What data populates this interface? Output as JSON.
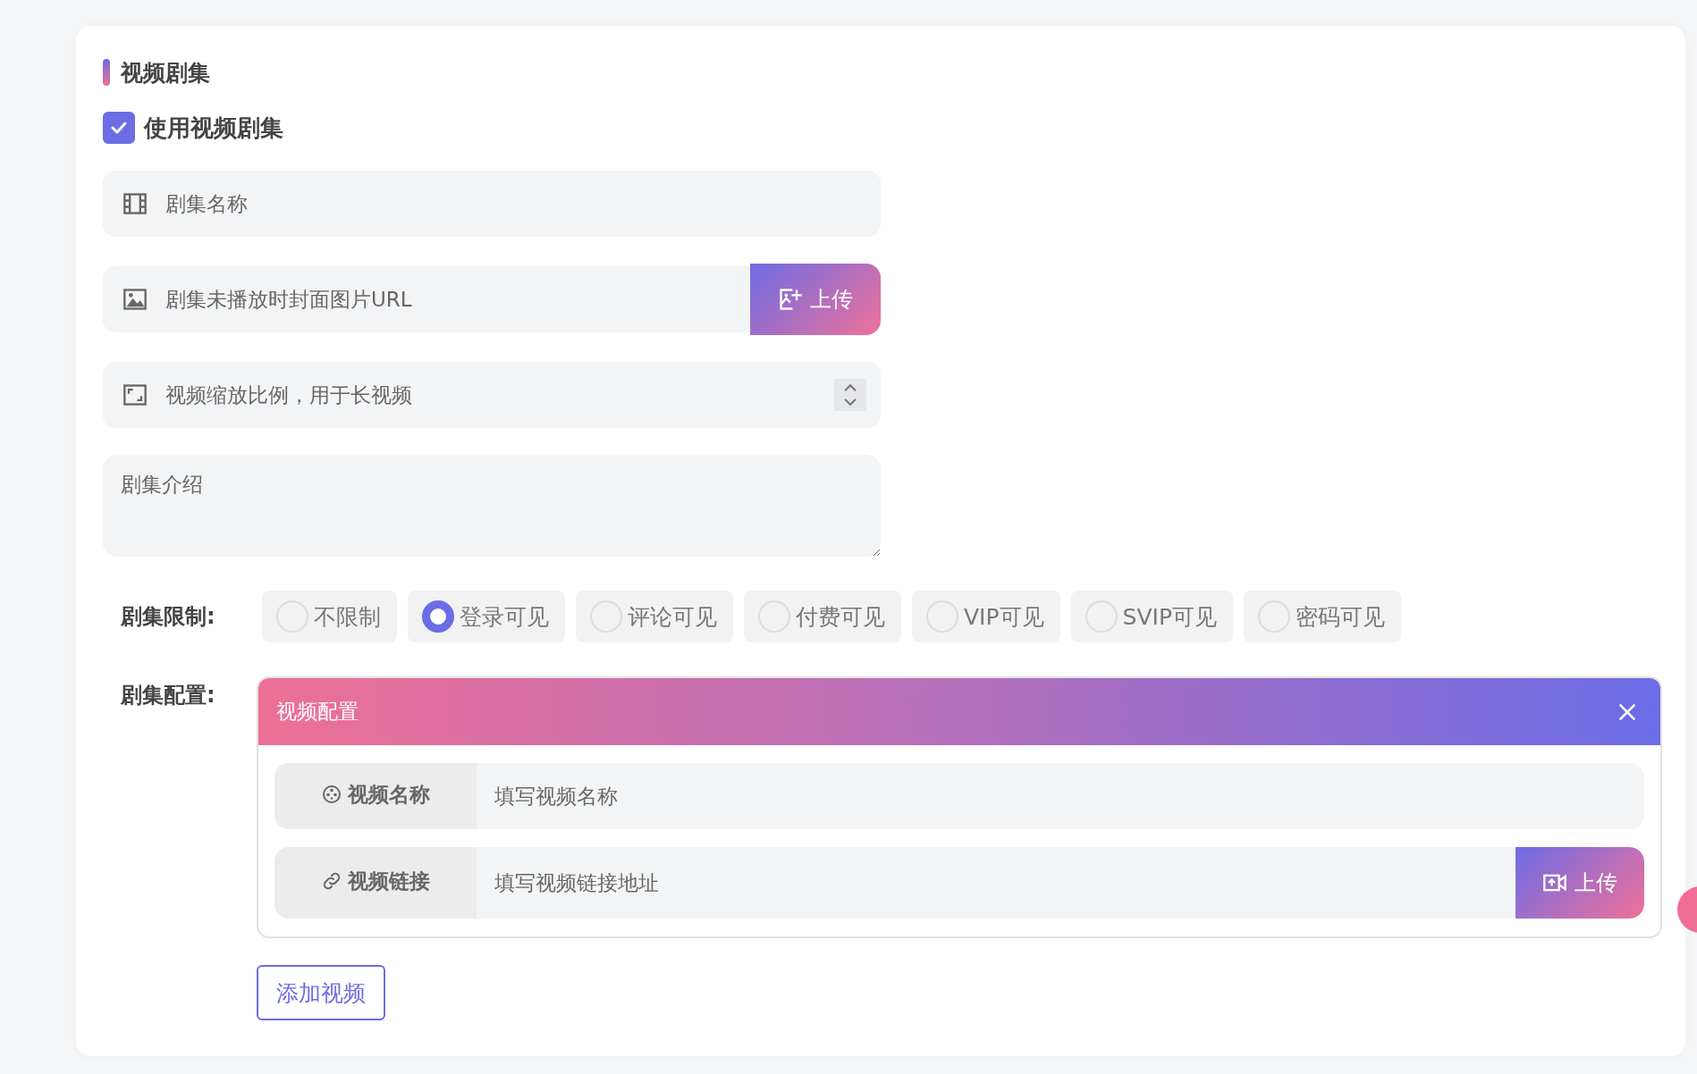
{
  "section": {
    "title": "视频剧集"
  },
  "use_series": {
    "label": "使用视频剧集",
    "checked": true
  },
  "fields": [
    {
      "kind": "text",
      "placeholder": "剧集名称"
    },
    {
      "kind": "upload",
      "placeholder": "剧集未播放时封面图片URL",
      "button": "上传"
    },
    {
      "kind": "select",
      "placeholder": "视频缩放比例，用于长视频"
    },
    {
      "kind": "textarea",
      "placeholder": "剧集介绍"
    }
  ],
  "restriction": {
    "label": "剧集限制:",
    "options": [
      {
        "label": "不限制",
        "selected": false
      },
      {
        "label": "登录可见",
        "selected": true
      },
      {
        "label": "评论可见",
        "selected": false
      },
      {
        "label": "付费可见",
        "selected": false
      },
      {
        "label": "VIP可见",
        "selected": false
      },
      {
        "label": "SVIP可见",
        "selected": false
      },
      {
        "label": "密码可见",
        "selected": false
      }
    ]
  },
  "config": {
    "label": "剧集配置:",
    "panels": [
      {
        "title": "视频配置",
        "rows": [
          {
            "kind": "text",
            "label": "视频名称",
            "placeholder": "填写视频名称"
          },
          {
            "kind": "upload",
            "label": "视频链接",
            "placeholder": "填写视频链接地址",
            "button": "上传"
          }
        ]
      }
    ],
    "add_button": "添加视频"
  }
}
